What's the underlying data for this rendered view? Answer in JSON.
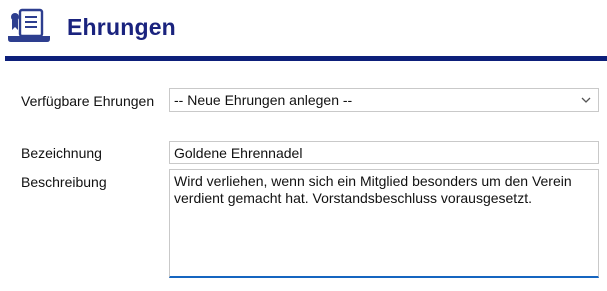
{
  "header": {
    "title": "Ehrungen",
    "icon": "certificate-scroll-icon",
    "accent_color": "#0d1f7a",
    "title_color": "#1a237e"
  },
  "form": {
    "available": {
      "label": "Verfügbare Ehrungen",
      "selected": "-- Neue Ehrungen anlegen --"
    },
    "name": {
      "label": "Bezeichnung",
      "value": "Goldene Ehrennadel"
    },
    "description": {
      "label": "Beschreibung",
      "value": "Wird verliehen, wenn sich ein Mitglied besonders um den Verein verdient gemacht hat. Vorstandsbeschluss vorausgesetzt."
    }
  }
}
